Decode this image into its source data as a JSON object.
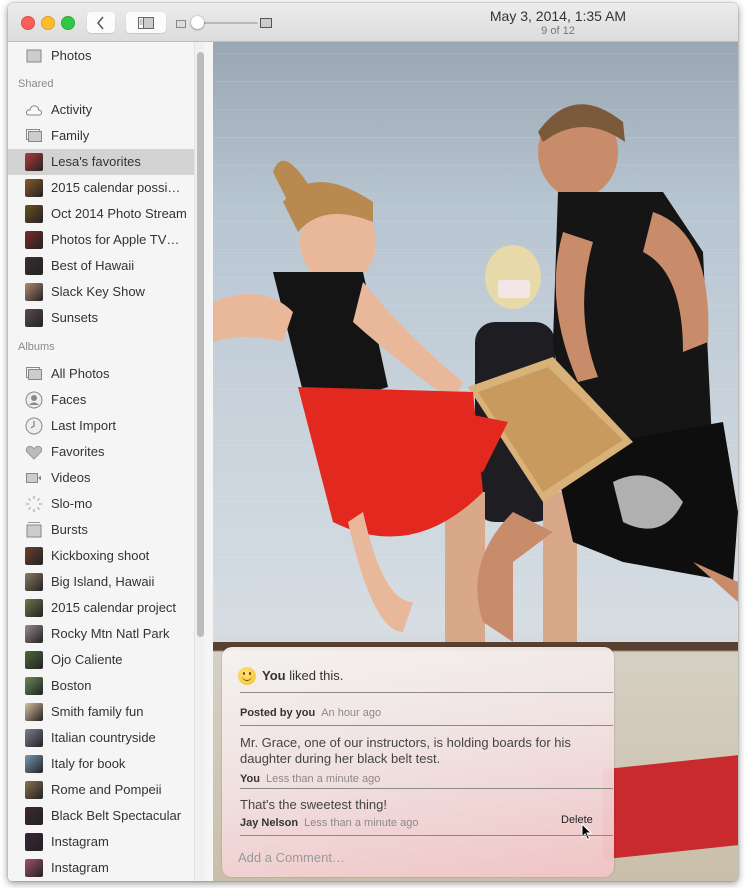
{
  "window": {
    "title_date": "May 3, 2014, 1:35 AM",
    "title_count": "9 of 12",
    "toolbar": {
      "back_icon": "chevron-left-icon",
      "sidebar_toggle_icon": "sidebar-icon",
      "zoom_slider": {
        "value_fraction": 0.0,
        "small_icon": "photo-small-icon",
        "large_icon": "photo-large-icon"
      }
    }
  },
  "sidebar": {
    "top_items": [
      {
        "label": "Photos",
        "icon": "photos-icon"
      }
    ],
    "shared_header": "Shared",
    "shared_items": [
      {
        "label": "Activity",
        "icon": "cloud-icon"
      },
      {
        "label": "Family",
        "icon": "stack-icon"
      },
      {
        "label": "Lesa's favorites",
        "icon": "album-thumbnail",
        "selected": true,
        "thumb_color": "#b33a3a"
      },
      {
        "label": "2015 calendar possi…",
        "icon": "album-thumbnail",
        "thumb_color": "#8a5a2a"
      },
      {
        "label": "Oct 2014 Photo Stream",
        "icon": "album-thumbnail",
        "thumb_color": "#6a5020"
      },
      {
        "label": "Photos for Apple TV…",
        "icon": "album-thumbnail",
        "thumb_color": "#7a2a2a"
      },
      {
        "label": "Best of Hawaii",
        "icon": "album-thumbnail",
        "thumb_color": "#3a3030"
      },
      {
        "label": "Slack Key Show",
        "icon": "album-thumbnail",
        "thumb_color": "#b08a70"
      },
      {
        "label": "Sunsets",
        "icon": "album-thumbnail",
        "thumb_color": "#5a4a55"
      }
    ],
    "albums_header": "Albums",
    "album_items": [
      {
        "label": "All Photos",
        "icon": "stack-icon"
      },
      {
        "label": "Faces",
        "icon": "faces-icon"
      },
      {
        "label": "Last Import",
        "icon": "clock-icon"
      },
      {
        "label": "Favorites",
        "icon": "heart-icon"
      },
      {
        "label": "Videos",
        "icon": "video-icon"
      },
      {
        "label": "Slo-mo",
        "icon": "slomo-icon"
      },
      {
        "label": "Bursts",
        "icon": "bursts-icon"
      },
      {
        "label": "Kickboxing shoot",
        "icon": "album-thumbnail",
        "thumb_color": "#6a4030"
      },
      {
        "label": "Big Island, Hawaii",
        "icon": "album-thumbnail",
        "thumb_color": "#8a7a60"
      },
      {
        "label": "2015 calendar project",
        "icon": "album-thumbnail",
        "thumb_color": "#6a7a4a"
      },
      {
        "label": "Rocky Mtn Natl Park",
        "icon": "album-thumbnail",
        "thumb_color": "#9a8a8a"
      },
      {
        "label": "Ojo Caliente",
        "icon": "album-thumbnail",
        "thumb_color": "#4a6a3a"
      },
      {
        "label": "Boston",
        "icon": "album-thumbnail",
        "thumb_color": "#6a8a5a"
      },
      {
        "label": "Smith family fun",
        "icon": "album-thumbnail",
        "thumb_color": "#d8c0a0"
      },
      {
        "label": "Italian countryside",
        "icon": "album-thumbnail",
        "thumb_color": "#7a8090"
      },
      {
        "label": "Italy for book",
        "icon": "album-thumbnail",
        "thumb_color": "#7a98b0"
      },
      {
        "label": "Rome and Pompeii",
        "icon": "album-thumbnail",
        "thumb_color": "#8a7050"
      },
      {
        "label": "Black Belt Spectacular",
        "icon": "album-thumbnail",
        "thumb_color": "#3a2a2a"
      },
      {
        "label": "Instagram",
        "icon": "album-thumbnail",
        "thumb_color": "#3a2535"
      },
      {
        "label": "Instagram",
        "icon": "album-thumbnail",
        "thumb_color": "#a05070"
      }
    ]
  },
  "comments_panel": {
    "like": {
      "icon": "smiley-icon",
      "who": "You",
      "text": " liked this."
    },
    "posted": {
      "by": "Posted by you",
      "when": "An hour ago"
    },
    "comments": [
      {
        "text": "Mr. Grace, one of our instructors, is holding boards for his daughter during her black belt test.",
        "author": "You",
        "when": "Less than a minute ago"
      },
      {
        "text": "That's the sweetest thing!",
        "author": "Jay Nelson",
        "when": "Less than a minute ago",
        "action": "Delete"
      }
    ],
    "add_comment_placeholder": "Add a Comment…"
  }
}
